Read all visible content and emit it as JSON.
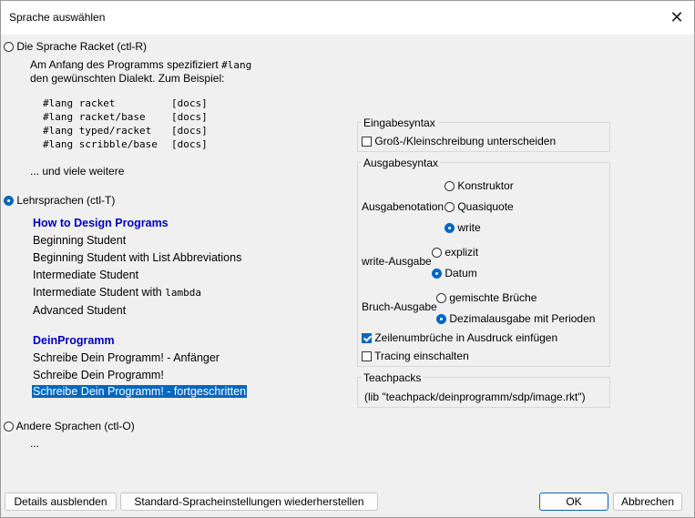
{
  "window": {
    "title": "Sprache auswählen"
  },
  "racket": {
    "radio_label": "Die Sprache Racket (ctl-R)",
    "desc_pre": "Am Anfang des Programms spezifiziert ",
    "desc_code": "#lang",
    "desc_line2": "den gewünschten Dialekt. Zum Beispiel:",
    "examples": [
      {
        "code": "#lang racket",
        "docs": "[docs]"
      },
      {
        "code": "#lang racket/base",
        "docs": "[docs]"
      },
      {
        "code": "#lang typed/racket",
        "docs": "[docs]"
      },
      {
        "code": "#lang scribble/base",
        "docs": "[docs]"
      }
    ],
    "more": "... und viele weitere"
  },
  "teaching": {
    "radio_label": "Lehrsprachen (ctl-T)",
    "htdp_heading": "How to Design Programs",
    "htdp_items": [
      "Beginning Student",
      "Beginning Student with List Abbreviations",
      "Intermediate Student",
      "Intermediate Student with "
    ],
    "lambda": "lambda",
    "advanced": "Advanced Student",
    "dp_heading": "DeinProgramm",
    "dp_items": [
      "Schreibe Dein Programm! - Anfänger",
      "Schreibe Dein Programm!",
      "Schreibe Dein Programm! - fortgeschritten"
    ]
  },
  "other": {
    "radio_label": "Andere Sprachen (ctl-O)",
    "ellipsis": "..."
  },
  "input_syntax": {
    "title": "Eingabesyntax",
    "case_label": "Groß-/Kleinschreibung unterscheiden"
  },
  "output_syntax": {
    "title": "Ausgabesyntax",
    "notation_label": "Ausgabenotation",
    "notation_options": [
      "Konstruktor",
      "Quasiquote",
      "write"
    ],
    "write_label": "write-Ausgabe",
    "write_options": [
      "explizit",
      "Datum"
    ],
    "fraction_label": "Bruch-Ausgabe",
    "fraction_options": [
      "gemischte Brüche",
      "Dezimalausgabe mit Perioden"
    ],
    "linebreak_label": "Zeilenumbrüche in Ausdruck einfügen",
    "tracing_label": "Tracing einschalten"
  },
  "teachpacks": {
    "title": "Teachpacks",
    "value": "(lib \"teachpack/deinprogramm/sdp/image.rkt\")"
  },
  "buttons": {
    "hide_details": "Details ausblenden",
    "restore_defaults": "Standard-Spracheinstellungen wiederherstellen",
    "ok": "OK",
    "cancel": "Abbrechen"
  },
  "colors": {
    "accent": "#0067c0",
    "heading": "#0000c0",
    "selection": "#0067c0"
  }
}
